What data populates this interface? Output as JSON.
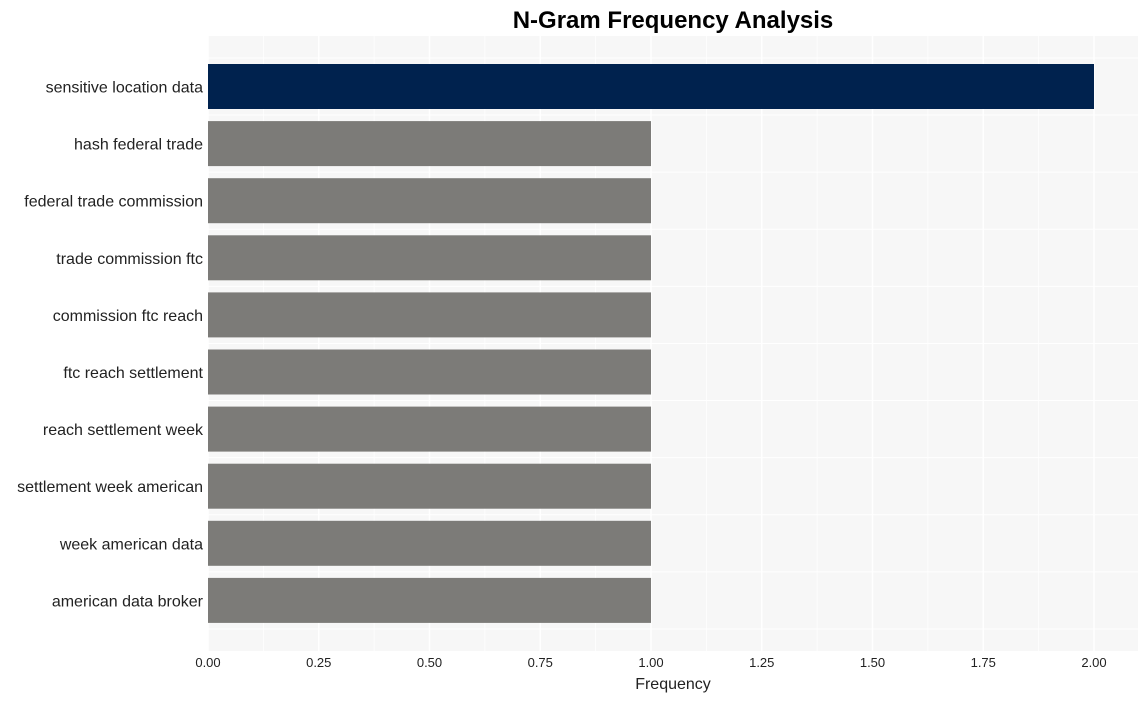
{
  "chart_data": {
    "type": "bar",
    "orientation": "horizontal",
    "title": "N-Gram Frequency Analysis",
    "xlabel": "Frequency",
    "ylabel": "",
    "xlim": [
      0,
      2.1
    ],
    "x_ticks": [
      0,
      0.25,
      0.5,
      0.75,
      1.0,
      1.25,
      1.5,
      1.75,
      2.0
    ],
    "x_tick_labels": [
      "0.00",
      "0.25",
      "0.50",
      "0.75",
      "1.00",
      "1.25",
      "1.50",
      "1.75",
      "2.00"
    ],
    "grid": true,
    "legend": "none",
    "categories": [
      "sensitive location data",
      "hash federal trade",
      "federal trade commission",
      "trade commission ftc",
      "commission ftc reach",
      "ftc reach settlement",
      "reach settlement week",
      "settlement week american",
      "week american data",
      "american data broker"
    ],
    "values": [
      2,
      1,
      1,
      1,
      1,
      1,
      1,
      1,
      1,
      1
    ],
    "bar_colors": [
      "#00224e",
      "#7c7b78",
      "#7c7b78",
      "#7c7b78",
      "#7c7b78",
      "#7c7b78",
      "#7c7b78",
      "#7c7b78",
      "#7c7b78",
      "#7c7b78"
    ],
    "panel_background": "#f7f7f7",
    "grid_color": "#ffffff"
  }
}
